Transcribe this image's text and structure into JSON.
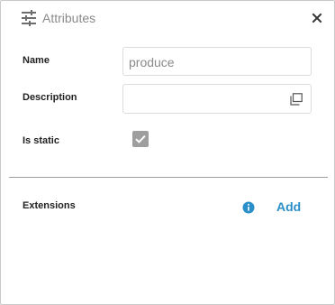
{
  "header": {
    "title": "Attributes",
    "icon": "tune-icon",
    "close_icon": "close-icon"
  },
  "fields": {
    "name": {
      "label": "Name",
      "value": "produce"
    },
    "description": {
      "label": "Description",
      "value": "",
      "icon": "expand-editor-icon"
    },
    "is_static": {
      "label": "Is static",
      "checked": true
    }
  },
  "extensions": {
    "label": "Extensions",
    "info_icon": "info-icon",
    "add_label": "Add"
  },
  "colors": {
    "accent": "#2b8fc7",
    "muted_text": "#8a8a8a",
    "checkbox_fill": "#9e9e9e",
    "divider": "#9e9e9e"
  }
}
